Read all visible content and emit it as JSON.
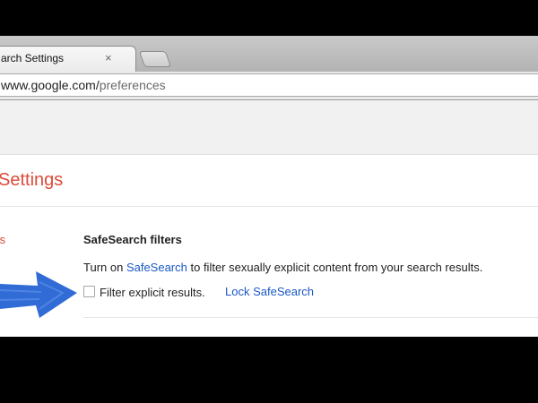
{
  "tab": {
    "title": "arch Settings",
    "close_glyph": "×"
  },
  "address_bar": {
    "host": "www.google.com/",
    "path": "preferences"
  },
  "page": {
    "title": "Settings"
  },
  "nav": {
    "partial_item": "ts"
  },
  "safesearch": {
    "section_title": "SafeSearch filters",
    "description_prefix": "Turn on ",
    "description_link": "SafeSearch",
    "description_suffix": " to filter sexually explicit content from your search results.",
    "checkbox_checked": false,
    "checkbox_label": "Filter explicit results.",
    "lock_link": "Lock SafeSearch"
  },
  "colors": {
    "title_red": "#dd4b39",
    "link_blue": "#1a58c5",
    "arrow_blue": "#1f5ed1"
  },
  "icons": {
    "annotation_arrow": "hand-drawn-arrow-icon"
  }
}
